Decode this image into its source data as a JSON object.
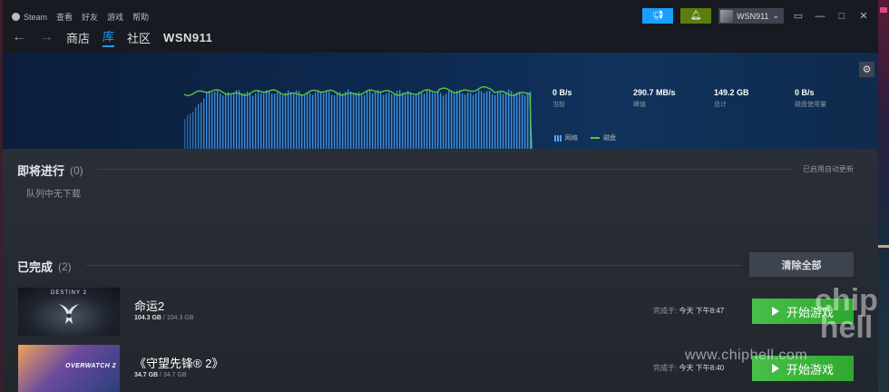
{
  "menu": {
    "brand": "Steam",
    "items": [
      "查看",
      "好友",
      "游戏",
      "帮助"
    ]
  },
  "nav": {
    "back_icon": "arrow-left-icon",
    "forward_icon": "arrow-right-icon",
    "store": "商店",
    "library": "库",
    "community": "社区",
    "username": "WSN911"
  },
  "account": {
    "name": "WSN911",
    "caret": "⌄"
  },
  "graph": {
    "stats": [
      {
        "value": "0 B/s",
        "label": "当前"
      },
      {
        "value": "290.7 MB/s",
        "label": "峰值"
      },
      {
        "value": "149.2 GB",
        "label": "总计"
      },
      {
        "value": "0 B/s",
        "label": "磁盘使用量"
      }
    ],
    "legend": {
      "network": "网络",
      "disk": "磁盘"
    },
    "colors": {
      "network": "#4aa8ff",
      "disk": "#5ec53c"
    }
  },
  "upcoming": {
    "title": "即将进行",
    "count": "(0)",
    "auto_update": "已启用自动更新",
    "empty_text": "队列中无下载"
  },
  "completed": {
    "title": "已完成",
    "count": "(2)",
    "clear_all": "清除全部",
    "games": [
      {
        "name": "命运2",
        "size_current": "104.3 GB",
        "size_sep": "/",
        "size_total": "104.3 GB",
        "done_label": "完成于:",
        "done_time": "今天 下午8:47",
        "play_label": "开始游戏",
        "thumb_text": "DESTINY 2"
      },
      {
        "name": "《守望先锋® 2》",
        "size_current": "34.7 GB",
        "size_sep": "/",
        "size_total": "34.7 GB",
        "done_label": "完成于:",
        "done_time": "今天 下午8:40",
        "play_label": "开始游戏",
        "thumb_text": "OVERWATCH 2"
      }
    ]
  },
  "watermark": {
    "site": "www.chiphell.com",
    "logo": "chip hell"
  }
}
